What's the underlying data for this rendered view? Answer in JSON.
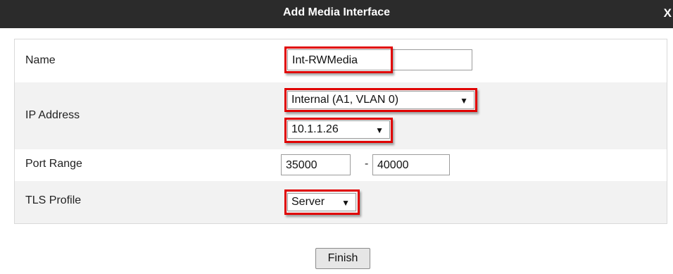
{
  "dialog": {
    "title": "Add Media Interface",
    "close_label": "X"
  },
  "fields": {
    "name": {
      "label": "Name",
      "value": "Int-RWMedia"
    },
    "ip_address": {
      "label": "IP Address",
      "interface_value": "Internal (A1, VLAN 0)",
      "ip_value": "10.1.1.26"
    },
    "port_range": {
      "label": "Port Range",
      "start": "35000",
      "separator": "-",
      "end": "40000"
    },
    "tls_profile": {
      "label": "TLS Profile",
      "value": "Server"
    }
  },
  "actions": {
    "finish_label": "Finish"
  },
  "colors": {
    "highlight": "#e00000",
    "titlebar": "#2b2b2b",
    "row_alt": "#f2f2f2"
  }
}
